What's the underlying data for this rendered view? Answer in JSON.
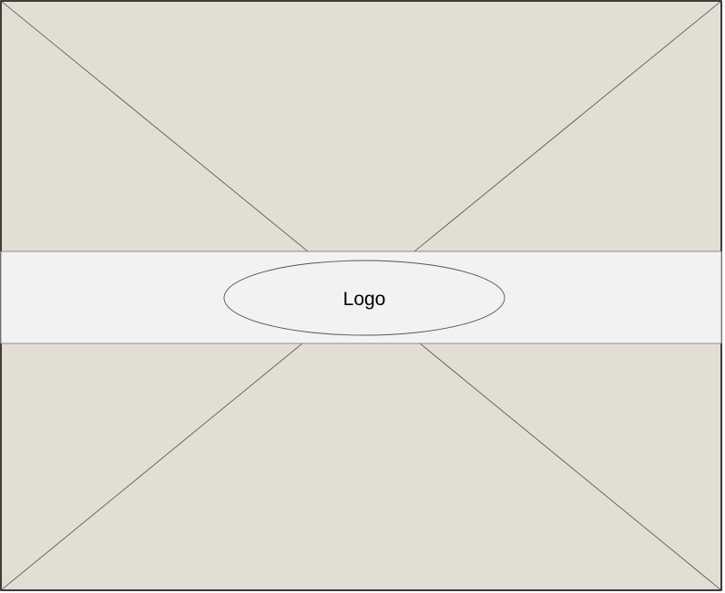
{
  "placeholder": {
    "logo_label": "Logo"
  },
  "colors": {
    "image_fill": "#e3ded3",
    "band_fill": "#f2f2f2",
    "stroke": "#333333"
  }
}
